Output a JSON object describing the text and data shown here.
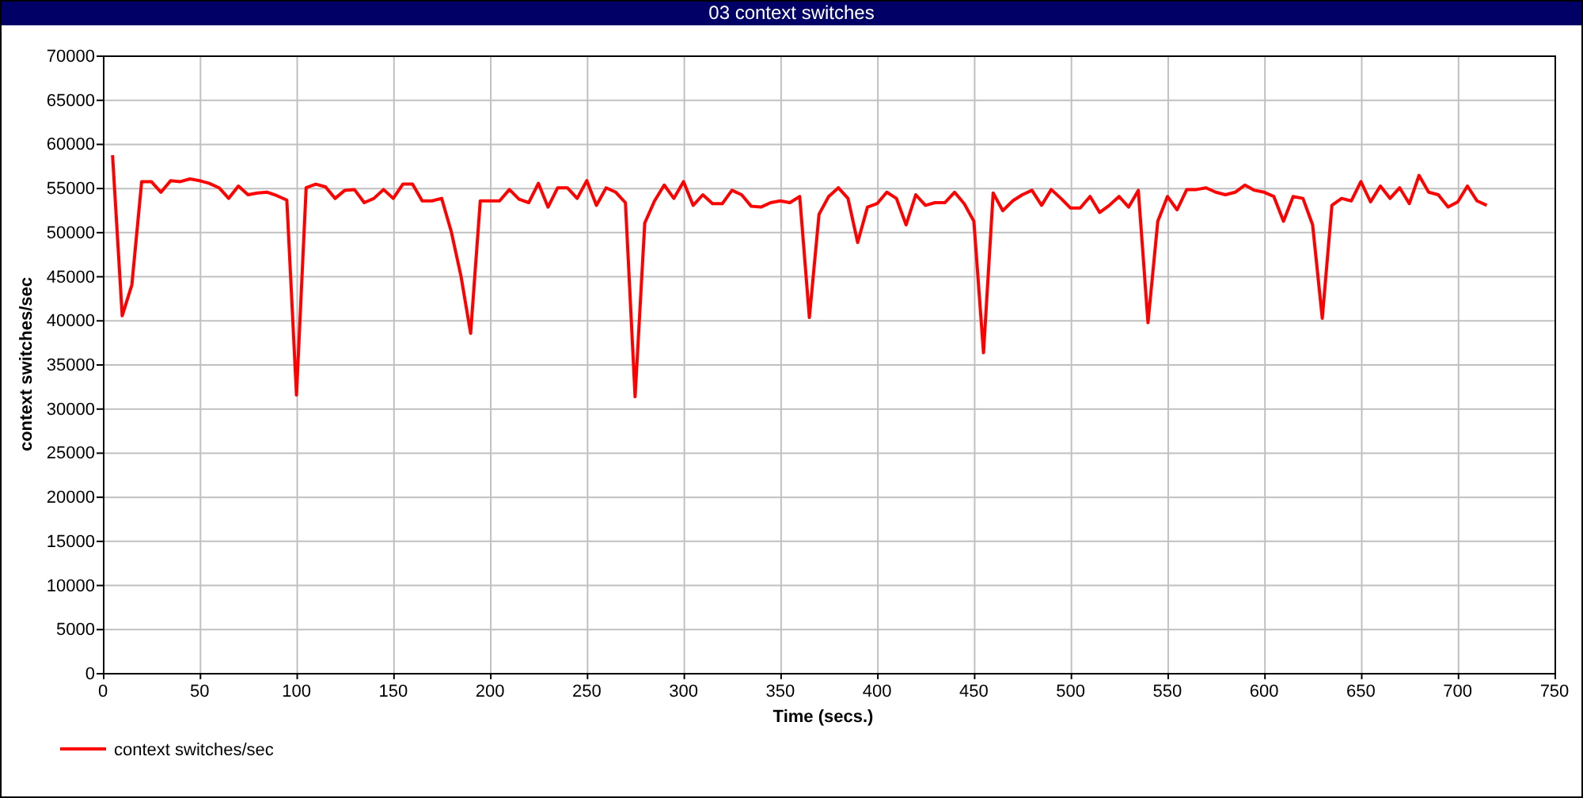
{
  "window": {
    "title": "03 context switches"
  },
  "chart": {
    "chart_data": {
      "type": "line",
      "grid": true,
      "xlabel": "Time (secs.)",
      "ylabel": "context switches/sec",
      "xlim": [
        0,
        750
      ],
      "ylim": [
        0,
        70000
      ],
      "xticks": [
        0,
        50,
        100,
        150,
        200,
        250,
        300,
        350,
        400,
        450,
        500,
        550,
        600,
        650,
        700,
        750
      ],
      "yticks": [
        0,
        5000,
        10000,
        15000,
        20000,
        25000,
        30000,
        35000,
        40000,
        45000,
        50000,
        55000,
        60000,
        65000,
        70000
      ],
      "x": [
        5,
        10,
        15,
        20,
        25,
        30,
        35,
        40,
        45,
        50,
        55,
        60,
        65,
        70,
        75,
        80,
        85,
        90,
        95,
        100,
        105,
        110,
        115,
        120,
        125,
        130,
        135,
        140,
        145,
        150,
        155,
        160,
        165,
        170,
        175,
        180,
        185,
        190,
        195,
        200,
        205,
        210,
        215,
        220,
        225,
        230,
        235,
        240,
        245,
        250,
        255,
        260,
        265,
        270,
        275,
        280,
        285,
        290,
        295,
        300,
        305,
        310,
        315,
        320,
        325,
        330,
        335,
        340,
        345,
        350,
        355,
        360,
        365,
        370,
        375,
        380,
        385,
        390,
        395,
        400,
        405,
        410,
        415,
        420,
        425,
        430,
        435,
        440,
        445,
        450,
        455,
        460,
        465,
        470,
        475,
        480,
        485,
        490,
        495,
        500,
        505,
        510,
        515,
        520,
        525,
        530,
        535,
        540,
        545,
        550,
        555,
        560,
        565,
        570,
        575,
        580,
        585,
        590,
        595,
        600,
        605,
        610,
        615,
        620,
        625,
        630,
        635,
        640,
        645,
        650,
        655,
        660,
        665,
        670,
        675,
        680,
        685,
        690,
        695,
        700,
        705,
        710,
        715
      ],
      "series": [
        {
          "name": "context switches/sec",
          "color": "#ff0000",
          "values": [
            58700,
            40500,
            44000,
            55700,
            55700,
            54500,
            55800,
            55700,
            56000,
            55800,
            55500,
            55000,
            53800,
            55200,
            54200,
            54400,
            54500,
            54100,
            53600,
            31500,
            55000,
            55400,
            55100,
            53800,
            54700,
            54800,
            53300,
            53800,
            54800,
            53800,
            55400,
            55400,
            53500,
            53500,
            53800,
            50000,
            45000,
            38500,
            53500,
            53500,
            53500,
            54800,
            53700,
            53300,
            55500,
            52800,
            55000,
            55000,
            53800,
            55800,
            53000,
            55000,
            54500,
            53300,
            31300,
            51000,
            53500,
            55300,
            53800,
            55700,
            53000,
            54200,
            53200,
            53200,
            54700,
            54200,
            52900,
            52800,
            53300,
            53500,
            53300,
            54000,
            40300,
            52000,
            54000,
            55000,
            53800,
            48800,
            52800,
            53200,
            54500,
            53800,
            50800,
            54200,
            53000,
            53300,
            53300,
            54500,
            53200,
            51200,
            36300,
            54400,
            52400,
            53500,
            54200,
            54700,
            53000,
            54800,
            53800,
            52700,
            52700,
            54000,
            52200,
            53000,
            54000,
            52800,
            54700,
            39700,
            51200,
            54000,
            52500,
            54800,
            54800,
            55000,
            54500,
            54200,
            54500,
            55300,
            54700,
            54500,
            54000,
            51200,
            54000,
            53800,
            50800,
            40200,
            53000,
            53800,
            53500,
            55700,
            53400,
            55200,
            53800,
            55000,
            53200,
            56400,
            54500,
            54200,
            52800,
            53400,
            55200,
            53500,
            53000
          ]
        }
      ]
    }
  }
}
